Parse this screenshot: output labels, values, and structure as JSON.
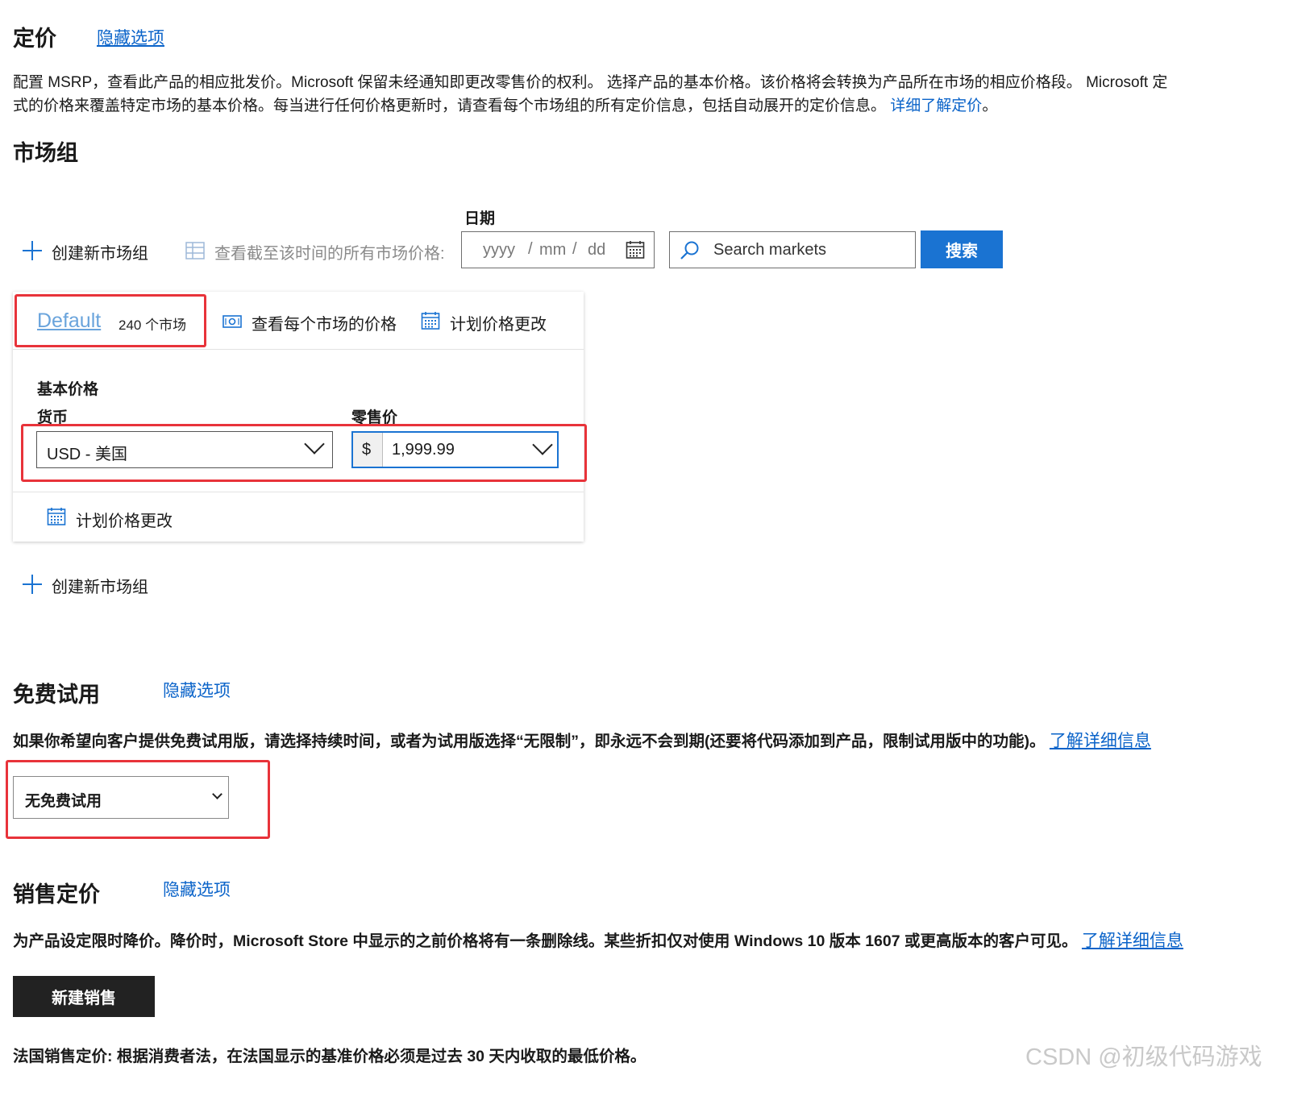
{
  "pricing": {
    "title": "定价",
    "hide_link": "隐藏选项",
    "desc_line1": "配置 MSRP，查看此产品的相应批发价。Microsoft 保留未经通知即更改零售价的权利。 选择产品的基本价格。该价格将会转换为产品所在市场的相应价格段。 Microsoft 定",
    "desc_line2": "式的价格来覆盖特定市场的基本价格。每当进行任何价格更新时，请查看每个市场组的所有定价信息，包括自动展开的定价信息。",
    "desc_link": "详细了解定价",
    "desc_end": "。"
  },
  "market_groups": {
    "title": "市场组",
    "date_label": "日期",
    "create_label": "创建新市场组",
    "view_all_label": "查看截至该时间的所有市场价格:",
    "date_placeholder": {
      "yyyy": "yyyy",
      "sep1": "/",
      "mm": "mm",
      "sep2": "/",
      "dd": "dd"
    },
    "search_placeholder": "Search markets",
    "search_button": "搜索",
    "card": {
      "tab_name": "Default",
      "tab_count": "240 个市场",
      "view_each": "查看每个市场的价格",
      "schedule": "计划价格更改",
      "base_price_title": "基本价格",
      "currency_label": "货币",
      "currency_value": "USD - 美国",
      "retail_label": "零售价",
      "retail_symbol": "$",
      "retail_value": "1,999.99",
      "schedule_bottom": "计划价格更改"
    },
    "create_label_bottom": "创建新市场组"
  },
  "free_trial": {
    "title": "免费试用",
    "hide_link": "隐藏选项",
    "desc": "如果你希望向客户提供免费试用版，请选择持续时间，或者为试用版选择“无限制”，即永远不会到期(还要将代码添加到产品，限制试用版中的功能)。",
    "learn_more": "了解详细信息",
    "select_value": "无免费试用"
  },
  "sale_pricing": {
    "title": "销售定价",
    "hide_link": "隐藏选项",
    "desc": "为产品设定限时降价。降价时，Microsoft Store 中显示的之前价格将有一条删除线。某些折扣仅对使用 Windows 10 版本 1607 或更高版本的客户可见。",
    "learn_more": "了解详细信息",
    "new_sale_button": "新建销售",
    "france_note": "法国销售定价: 根据消费者法，在法国显示的基准价格必须是过去 30 天内收取的最低价格。"
  },
  "watermark": "CSDN @初级代码游戏",
  "colors": {
    "accent": "#0a63c9",
    "primary_button": "#1a73d2",
    "dark_button": "#222222",
    "highlight": "#e8333a"
  }
}
